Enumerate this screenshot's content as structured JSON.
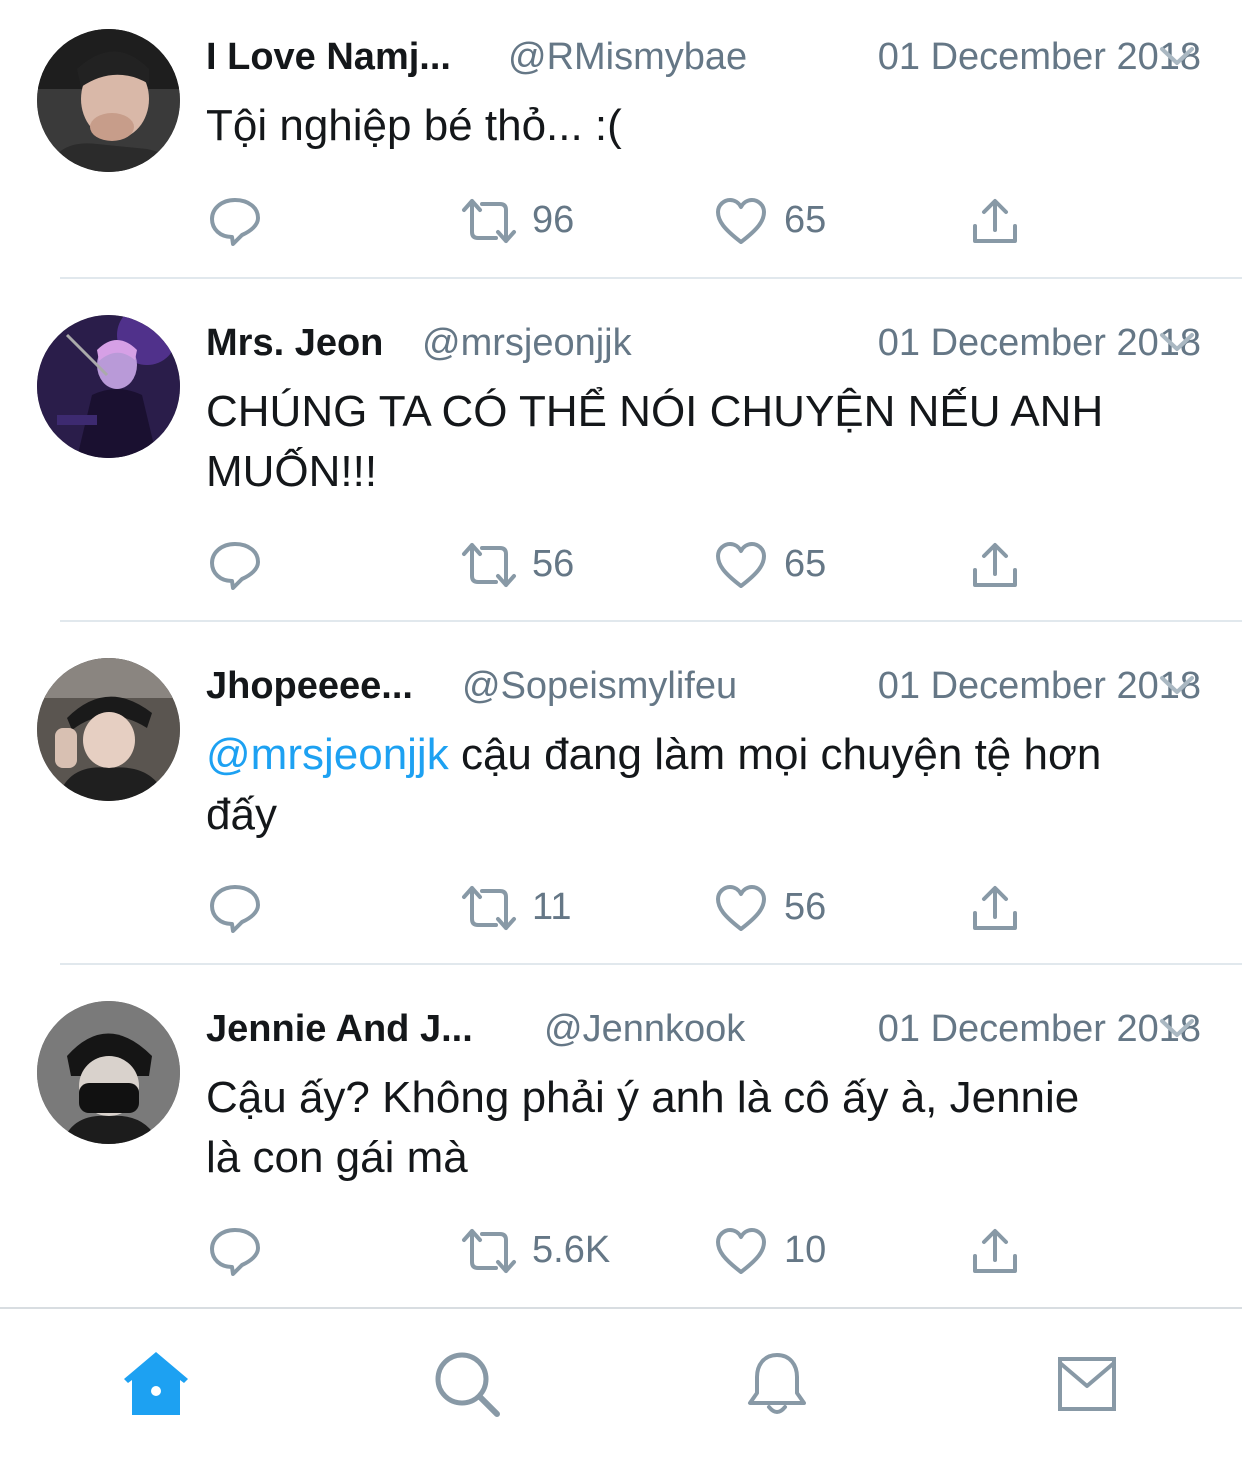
{
  "tweets": [
    {
      "name": "I Love Namj...",
      "handle": "@RMismybae",
      "date": "01 December 2018",
      "text": "Tội nghiệp bé thỏ... :(",
      "mention": "",
      "retweets": "96",
      "likes": "65"
    },
    {
      "name": "Mrs. Jeon",
      "handle": "@mrsjeonjjk",
      "date": "01 December 2018",
      "text_line1": "CHÚNG TA CÓ THỂ NÓI CHUYỆN NẾU ANH",
      "text_line2": "MUỐN!!!",
      "retweets": "56",
      "likes": "65"
    },
    {
      "name": "Jhopeeee...",
      "handle": "@Sopeismylifeu",
      "date": "01 December 2018",
      "mention": "@mrsjeonjjk",
      "text_after_mention": " cậu đang làm mọi chuyện tệ hơn",
      "text_line2": "đấy",
      "retweets": "11",
      "likes": "56"
    },
    {
      "name": "Jennie And J...",
      "handle": "@Jennkook",
      "date": "01 December 2018",
      "text_line1": "Cậu ấy? Không phải ý anh là cô ấy à, Jennie",
      "text_line2": "là con gái mà",
      "retweets": "5.6K",
      "likes": "10"
    }
  ],
  "icons": {
    "reply": "reply-icon",
    "retweet": "retweet-icon",
    "like": "heart-icon",
    "share": "share-icon",
    "menu": "chevron-down-icon"
  },
  "tabbar": {
    "tabs": [
      "home-icon",
      "search-icon",
      "bell-icon",
      "mail-icon"
    ],
    "active_color": "#1da1f2",
    "inactive_color": "#8899a6"
  },
  "colors": {
    "link": "#1da1f2",
    "secondary": "#657786",
    "icon": "#8899a6"
  }
}
